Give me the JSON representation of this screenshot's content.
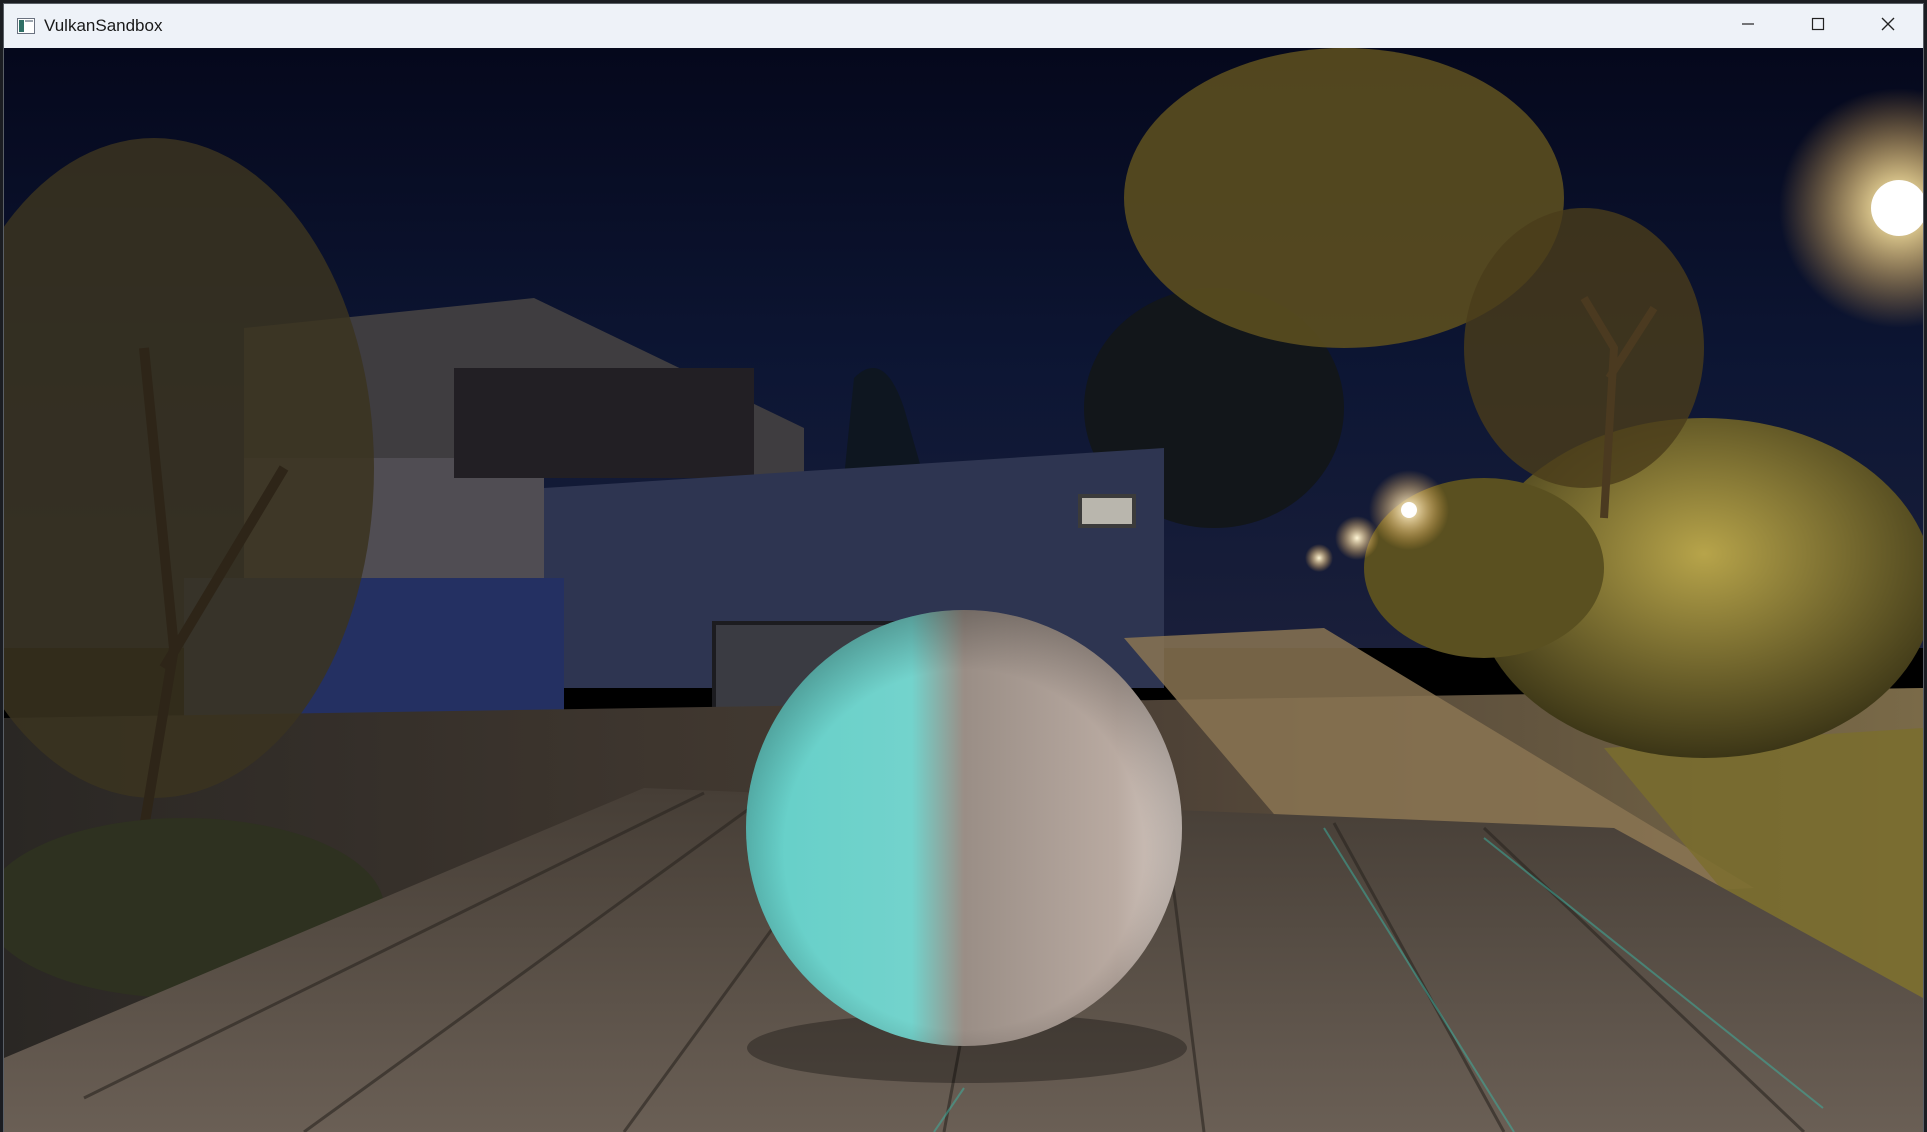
{
  "window": {
    "title": "VulkanSandbox",
    "icon": "app-window-icon"
  },
  "controls": {
    "minimize_icon": "minimize-icon",
    "maximize_icon": "maximize-icon",
    "close_icon": "close-icon"
  },
  "scene": {
    "sky_color": "#0a0f2a",
    "building_color": "#2f3856",
    "ground_color": "#4a4038",
    "table_color": "#5a5148",
    "sphere_lit_color": "#6fd3cc",
    "sphere_shadow_color": "#b8a79d",
    "lamp_color": "#fff3c0",
    "foliage_color": "#6b5a22"
  }
}
